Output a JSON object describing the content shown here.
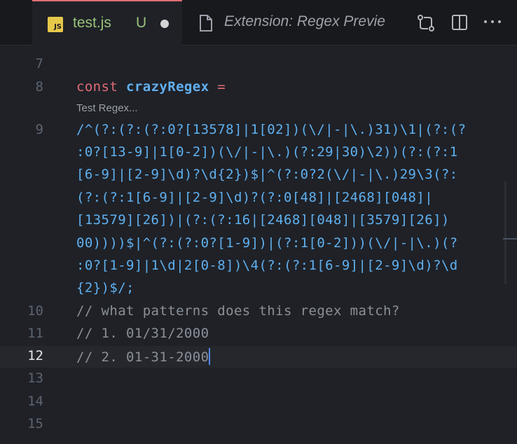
{
  "tabs": {
    "active": {
      "badge": "JS",
      "name": "test.js",
      "status": "U"
    },
    "inactive": {
      "name": "Extension: Regex Previe"
    }
  },
  "icons": [
    "js-file-icon",
    "file-icon",
    "compare-changes-icon",
    "split-editor-icon",
    "more-actions-icon"
  ],
  "colors": {
    "background": "#1f2127",
    "tab_active_border": "#e06c75",
    "keyword": "#e06c75",
    "regex": "#5fb0ef",
    "comment": "#8a8f98",
    "untracked": "#98c379"
  },
  "editor": {
    "line_numbers": [
      "7",
      "8",
      "9",
      "10",
      "11",
      "12",
      "13",
      "14",
      "15"
    ],
    "active_line": "12",
    "code_line_8": {
      "keyword": "const",
      "name": "crazyRegex",
      "op": "="
    },
    "codelens": "Test Regex...",
    "regex_lines": [
      "/^(?:(?:(?:0?[13578]|1[02])(\\/|-|\\.)31)\\1|(?:(?",
      ":0?[13-9]|1[0-2])(\\/|-|\\.)(?:29|30)\\2))(?:(?:1",
      "[6-9]|[2-9]\\d)?\\d{2})$|^(?:0?2(\\/|-|\\.)29\\3(?:",
      "(?:(?:1[6-9]|[2-9]\\d)?(?:0[48]|[2468][048]|",
      "[13579][26])|(?:(?:16|[2468][048]|[3579][26])",
      "00))))$|^(?:(?:0?[1-9])|(?:1[0-2]))(\\/|-|\\.)(?",
      ":0?[1-9]|1\\d|2[0-8])\\4(?:(?:1[6-9]|[2-9]\\d)?\\d",
      "{2})$/;"
    ],
    "comment_10": "// what patterns does this regex match?",
    "comment_11": "// 1. 01/31/2000",
    "comment_12": "// 2. 01-31-2000"
  }
}
